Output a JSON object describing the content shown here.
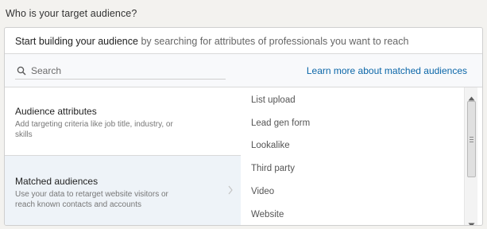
{
  "question": "Who is your target audience?",
  "intro": {
    "strong": "Start building your audience",
    "rest": " by searching for attributes of professionals you want to reach"
  },
  "search": {
    "placeholder": "Search",
    "value": ""
  },
  "learn_link": "Learn more about matched audiences",
  "categories": [
    {
      "title": "Audience attributes",
      "desc": "Add targeting criteria like job title, industry, or skills"
    },
    {
      "title": "Matched audiences",
      "desc": "Use your data to retarget website visitors or reach known contacts and accounts"
    }
  ],
  "options": [
    "List upload",
    "Lead gen form",
    "Lookalike",
    "Third party",
    "Video",
    "Website"
  ],
  "icons": {
    "search": "search-icon",
    "chevron": "chevron-right-icon",
    "scroll_up": "arrow-up-icon",
    "scroll_down": "arrow-down-icon"
  },
  "colors": {
    "link": "#0a66a8",
    "selected_bg": "#eef3f8",
    "page_bg": "#f3f2ef"
  }
}
